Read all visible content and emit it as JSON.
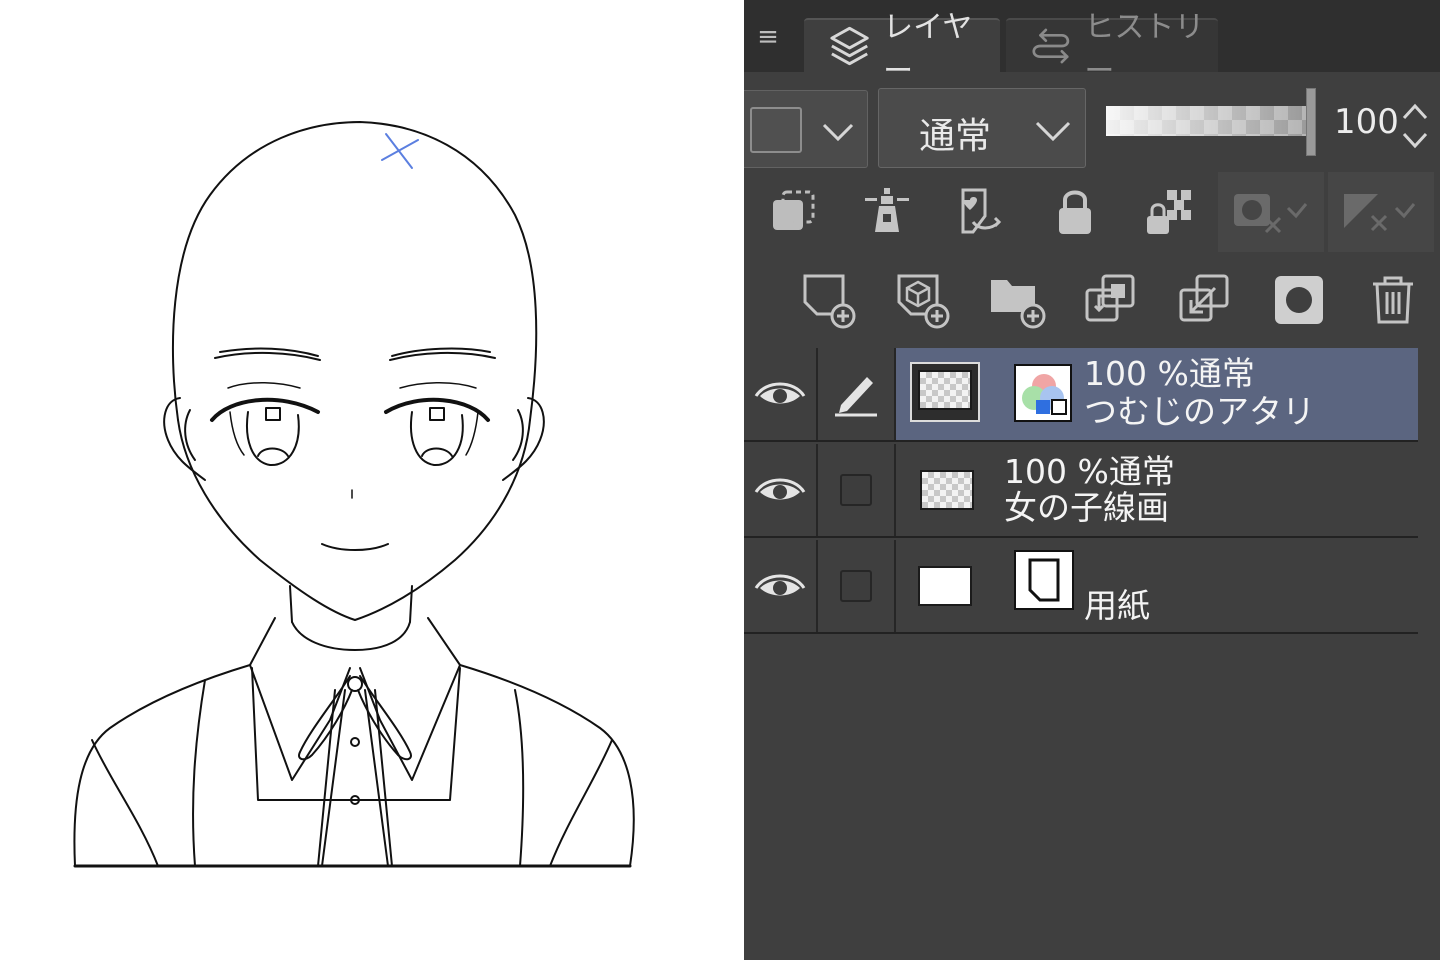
{
  "tabs": [
    {
      "label": "レイヤー",
      "icon": "layers-icon",
      "active": true
    },
    {
      "label": "ヒストリー",
      "icon": "history-icon",
      "active": false
    }
  ],
  "toolbar": {
    "blend_mode": "通常",
    "opacity_value": "100",
    "opacity_level": 1.0
  },
  "layers": [
    {
      "opacity": "100 %",
      "mode": "通常",
      "name": "つむじのアタリ",
      "selected": true,
      "visible": true,
      "editing": true
    },
    {
      "opacity": "100 %",
      "mode": "通常",
      "name": "女の子線画",
      "selected": false,
      "visible": true,
      "editing": false
    },
    {
      "name": "用紙",
      "selected": false,
      "visible": true,
      "editing": false
    }
  ],
  "colors": {
    "panel_bg": "#3f3f3f",
    "selected_row": "#5b6580",
    "canvas_bg": "#ffffff",
    "guide_mark": "#5b7fe0"
  }
}
